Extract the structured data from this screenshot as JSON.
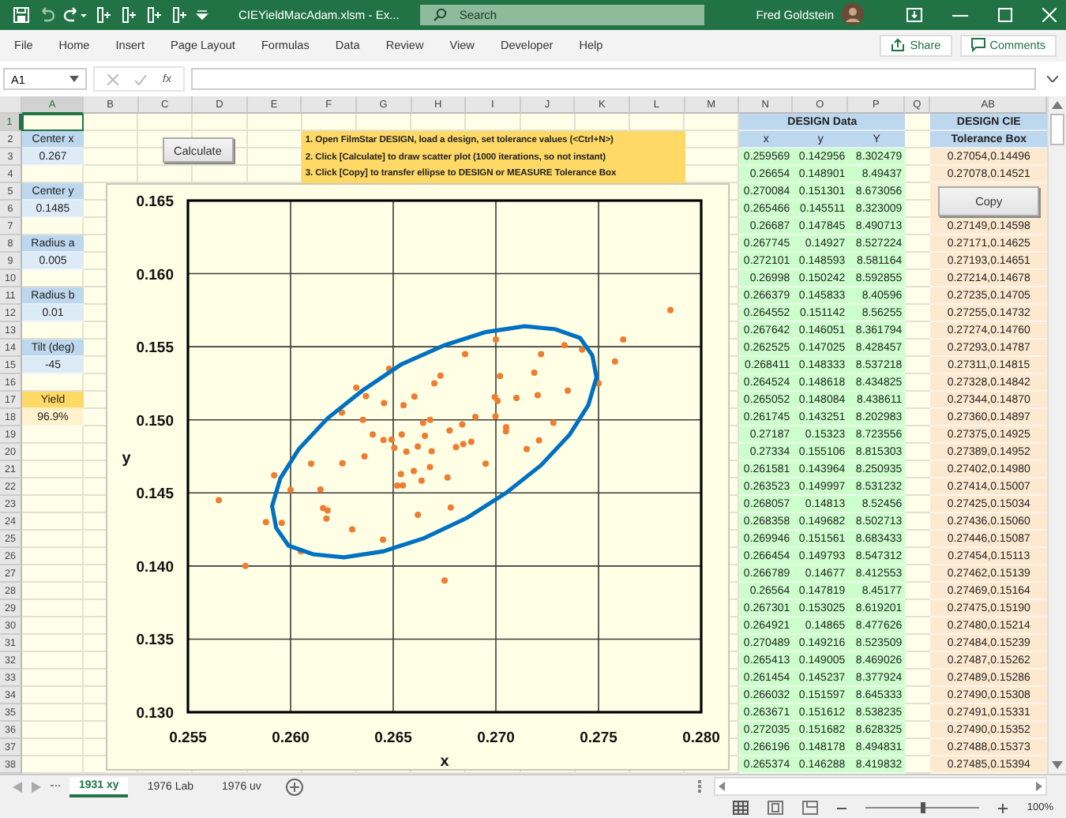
{
  "window": {
    "title": "CIEYieldMacAdam.xlsm  -  Ex...",
    "search_placeholder": "Search",
    "user": "Fred Goldstein"
  },
  "menu": [
    "File",
    "Home",
    "Insert",
    "Page Layout",
    "Formulas",
    "Data",
    "Review",
    "View",
    "Developer",
    "Help"
  ],
  "ribbon_buttons": [
    "Share",
    "Comments"
  ],
  "formula_bar": {
    "name_box": "A1",
    "function_label": "fx"
  },
  "sheet": {
    "columns": [
      "A",
      "B",
      "C",
      "D",
      "E",
      "F",
      "G",
      "H",
      "I",
      "J",
      "K",
      "L",
      "M",
      "N",
      "O",
      "P",
      "Q",
      "AB"
    ],
    "row_numbers": [
      "1",
      "2",
      "3",
      "4",
      "5",
      "6",
      "7",
      "8",
      "9",
      "10",
      "11",
      "12",
      "13",
      "14",
      "15",
      "16",
      "17",
      "18",
      "19",
      "20",
      "21",
      "22",
      "23",
      "24",
      "25",
      "26",
      "27",
      "28",
      "29",
      "30",
      "31",
      "32",
      "33",
      "34",
      "35",
      "36",
      "37",
      "38"
    ]
  },
  "parameters": [
    {
      "label": "Center x",
      "value": "0.267",
      "kind": "input"
    },
    {
      "label": "Center y",
      "value": "0.1485",
      "kind": "input"
    },
    {
      "label": "Radius a",
      "value": "0.005",
      "kind": "input"
    },
    {
      "label": "Radius b",
      "value": "0.01",
      "kind": "input"
    },
    {
      "label": "Tilt (deg)",
      "value": "-45",
      "kind": "input"
    },
    {
      "label": "Yield",
      "value": "96.9%",
      "kind": "result"
    }
  ],
  "calculate_button": "Calculate",
  "instructions": [
    "1. Open FilmStar DESIGN, load a design, set tolerance values (<Ctrl+N>)",
    "2. Click [Calculate] to draw scatter plot (1000 iterations, so not instant)",
    "3. Click [Copy] to transfer ellipse to DESIGN or MEASURE Tolerance Box"
  ],
  "design_data": {
    "title": "DESIGN Data",
    "columns": [
      "x",
      "y",
      "Y"
    ],
    "rows": [
      [
        "0.259569",
        "0.142956",
        "8.302479"
      ],
      [
        "0.26654",
        "0.148901",
        "8.49437"
      ],
      [
        "0.270084",
        "0.151301",
        "8.673056"
      ],
      [
        "0.265466",
        "0.145511",
        "8.323009"
      ],
      [
        "0.26687",
        "0.147845",
        "8.490713"
      ],
      [
        "0.267745",
        "0.14927",
        "8.527224"
      ],
      [
        "0.272101",
        "0.148593",
        "8.581164"
      ],
      [
        "0.26998",
        "0.150242",
        "8.592855"
      ],
      [
        "0.266379",
        "0.145833",
        "8.40596"
      ],
      [
        "0.264552",
        "0.151142",
        "8.56255"
      ],
      [
        "0.267642",
        "0.146051",
        "8.361794"
      ],
      [
        "0.262525",
        "0.147025",
        "8.428457"
      ],
      [
        "0.268411",
        "0.148333",
        "8.537218"
      ],
      [
        "0.264524",
        "0.148618",
        "8.434825"
      ],
      [
        "0.265052",
        "0.148084",
        "8.438611"
      ],
      [
        "0.261745",
        "0.143251",
        "8.202983"
      ],
      [
        "0.27187",
        "0.15323",
        "8.723556"
      ],
      [
        "0.27334",
        "0.155106",
        "8.815303"
      ],
      [
        "0.261581",
        "0.143964",
        "8.250935"
      ],
      [
        "0.263523",
        "0.149997",
        "8.531232"
      ],
      [
        "0.268057",
        "0.14813",
        "8.52456"
      ],
      [
        "0.268358",
        "0.149682",
        "8.502713"
      ],
      [
        "0.269946",
        "0.151561",
        "8.683433"
      ],
      [
        "0.266454",
        "0.149793",
        "8.547312"
      ],
      [
        "0.266789",
        "0.14677",
        "8.412553"
      ],
      [
        "0.26564",
        "0.147819",
        "8.45177"
      ],
      [
        "0.267301",
        "0.153025",
        "8.619201"
      ],
      [
        "0.264921",
        "0.14865",
        "8.477626"
      ],
      [
        "0.270489",
        "0.149216",
        "8.523509"
      ],
      [
        "0.265413",
        "0.149005",
        "8.469026"
      ],
      [
        "0.261454",
        "0.145237",
        "8.377924"
      ],
      [
        "0.266032",
        "0.151597",
        "8.645333"
      ],
      [
        "0.263671",
        "0.151612",
        "8.538235"
      ],
      [
        "0.272035",
        "0.151682",
        "8.628325"
      ],
      [
        "0.266196",
        "0.148178",
        "8.494831"
      ],
      [
        "0.265374",
        "0.146288",
        "8.419832"
      ]
    ]
  },
  "tolerance_box": {
    "title_lines": [
      "DESIGN CIE",
      "Tolerance Box"
    ],
    "values_before": [
      "0.27054,0.14496",
      "0.27078,0.14521"
    ],
    "copy_button": "Copy",
    "values_after": [
      "0.27149,0.14598",
      "0.27171,0.14625",
      "0.27193,0.14651",
      "0.27214,0.14678",
      "0.27235,0.14705",
      "0.27255,0.14732",
      "0.27274,0.14760",
      "0.27293,0.14787",
      "0.27311,0.14815",
      "0.27328,0.14842",
      "0.27344,0.14870",
      "0.27360,0.14897",
      "0.27375,0.14925",
      "0.27389,0.14952",
      "0.27402,0.14980",
      "0.27414,0.15007",
      "0.27425,0.15034",
      "0.27436,0.15060",
      "0.27446,0.15087",
      "0.27454,0.15113",
      "0.27462,0.15139",
      "0.27469,0.15164",
      "0.27475,0.15190",
      "0.27480,0.15214",
      "0.27484,0.15239",
      "0.27487,0.15262",
      "0.27489,0.15286",
      "0.27490,0.15308",
      "0.27491,0.15331",
      "0.27490,0.15352",
      "0.27488,0.15373",
      "0.27485,0.15394"
    ]
  },
  "chart": {
    "chart_data": {
      "type": "scatter",
      "xlabel": "x",
      "ylabel": "y",
      "grid": true,
      "xlim": [
        0.255,
        0.28
      ],
      "ylim": [
        0.13,
        0.165
      ],
      "xticks": [
        {
          "value": 0.255,
          "label": "0.255"
        },
        {
          "value": 0.26,
          "label": "0.260"
        },
        {
          "value": 0.265,
          "label": "0.265"
        },
        {
          "value": 0.27,
          "label": "0.270"
        },
        {
          "value": 0.275,
          "label": "0.275"
        },
        {
          "value": 0.28,
          "label": "0.280"
        }
      ],
      "yticks": [
        {
          "value": 0.13,
          "label": "0.130"
        },
        {
          "value": 0.135,
          "label": "0.135"
        },
        {
          "value": 0.14,
          "label": "0.140"
        },
        {
          "value": 0.145,
          "label": "0.145"
        },
        {
          "value": 0.15,
          "label": "0.150"
        },
        {
          "value": 0.155,
          "label": "0.155"
        },
        {
          "value": 0.16,
          "label": "0.160"
        },
        {
          "value": 0.165,
          "label": "0.165"
        }
      ],
      "series": [
        {
          "color": "#ed7d31",
          "x": [
            0.259569,
            0.26654,
            0.270084,
            0.265466,
            0.26687,
            0.267745,
            0.272101,
            0.26998,
            0.266379,
            0.264552,
            0.267642,
            0.262525,
            0.268411,
            0.264524,
            0.265052,
            0.261745,
            0.27187,
            0.27334,
            0.261581,
            0.263523,
            0.268057,
            0.268358,
            0.269946,
            0.266454,
            0.266789,
            0.26564,
            0.267301,
            0.264921,
            0.270489,
            0.265413,
            0.261454,
            0.266032,
            0.263671,
            0.272035,
            0.266196,
            0.265374,
            0.2785,
            0.2565,
            0.2578,
            0.2588,
            0.26,
            0.261,
            0.2625,
            0.2632,
            0.264,
            0.2648,
            0.2655,
            0.266,
            0.267,
            0.2678,
            0.2685,
            0.269,
            0.2695,
            0.2702,
            0.271,
            0.2715,
            0.2722,
            0.2728,
            0.2735,
            0.2742,
            0.275,
            0.2758,
            0.2618,
            0.263,
            0.2645,
            0.2662,
            0.2605,
            0.2675,
            0.2762,
            0.27,
            0.2592,
            0.2636,
            0.2652,
            0.2688,
            0.2705,
            0.2668
          ],
          "values": [
            0.142956,
            0.148901,
            0.151301,
            0.145511,
            0.147845,
            0.14927,
            0.148593,
            0.150242,
            0.145833,
            0.151142,
            0.146051,
            0.147025,
            0.148333,
            0.148618,
            0.148084,
            0.143251,
            0.15323,
            0.155106,
            0.143964,
            0.149997,
            0.14813,
            0.149682,
            0.151561,
            0.149793,
            0.14677,
            0.147819,
            0.153025,
            0.14865,
            0.149216,
            0.149005,
            0.145237,
            0.151597,
            0.151612,
            0.151682,
            0.148178,
            0.146288,
            0.1575,
            0.1445,
            0.14,
            0.143,
            0.1452,
            0.147,
            0.1505,
            0.1522,
            0.149,
            0.1535,
            0.151,
            0.1465,
            0.1525,
            0.144,
            0.1545,
            0.1502,
            0.147,
            0.153,
            0.1515,
            0.148,
            0.1545,
            0.1498,
            0.152,
            0.1548,
            0.1525,
            0.154,
            0.1438,
            0.1425,
            0.1418,
            0.1435,
            0.141,
            0.139,
            0.1555,
            0.1555,
            0.1462,
            0.1475,
            0.1455,
            0.1485,
            0.1495,
            0.15
          ]
        }
      ]
    }
  },
  "sheet_tabs": [
    {
      "label": "1931 xy",
      "selected": true
    },
    {
      "label": "1976 Lab",
      "selected": false
    },
    {
      "label": "1976 uv",
      "selected": false
    }
  ],
  "zoom": {
    "label": "100%",
    "level": 0.5
  }
}
